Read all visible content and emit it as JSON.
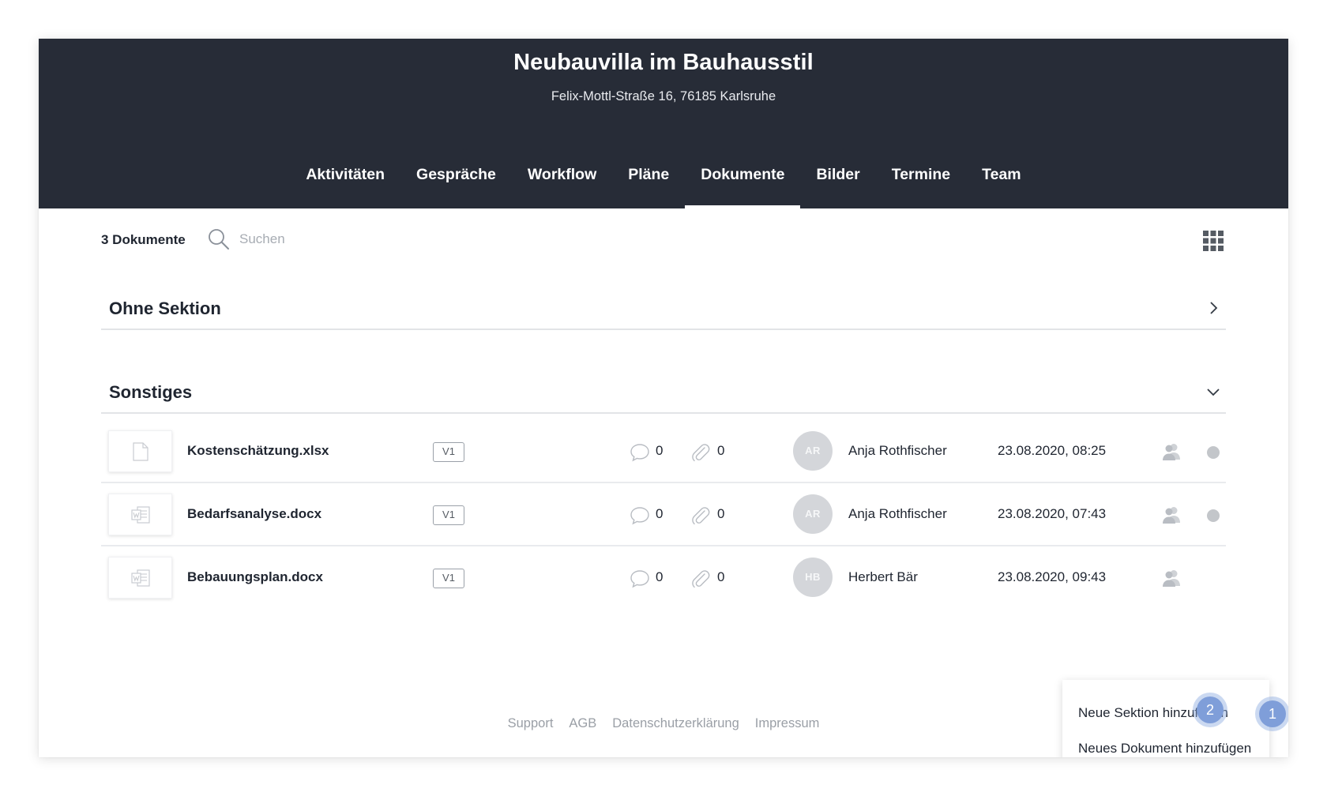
{
  "project": {
    "title": "Neubauvilla im Bauhausstil",
    "address": "Felix-Mottl-Straße 16, 76185 Karlsruhe"
  },
  "nav": {
    "tabs": [
      {
        "label": "Aktivitäten"
      },
      {
        "label": "Gespräche"
      },
      {
        "label": "Workflow"
      },
      {
        "label": "Pläne"
      },
      {
        "label": "Dokumente",
        "active": true
      },
      {
        "label": "Bilder"
      },
      {
        "label": "Termine"
      },
      {
        "label": "Team"
      }
    ]
  },
  "toolbar": {
    "doc_count": "3 Dokumente",
    "search_placeholder": "Suchen"
  },
  "sections": [
    {
      "title": "Ohne Sektion",
      "state": "collapsed"
    },
    {
      "title": "Sonstiges",
      "state": "expanded"
    }
  ],
  "documents": [
    {
      "name": "Kostenschätzung.xlsx",
      "version": "V1",
      "comments": "0",
      "attachments": "0",
      "initials": "AR",
      "author": "Anja Rothfischer",
      "date": "23.08.2020, 08:25",
      "thumb_icon": "file-icon",
      "status_dot": true
    },
    {
      "name": "Bedarfsanalyse.docx",
      "version": "V1",
      "comments": "0",
      "attachments": "0",
      "initials": "AR",
      "author": "Anja Rothfischer",
      "date": "23.08.2020, 07:43",
      "thumb_icon": "word-doc-icon",
      "status_dot": true
    },
    {
      "name": "Bebauungsplan.docx",
      "version": "V1",
      "comments": "0",
      "attachments": "0",
      "initials": "HB",
      "author": "Herbert Bär",
      "date": "23.08.2020, 09:43",
      "thumb_icon": "word-doc-icon",
      "status_dot": false
    }
  ],
  "footer": {
    "links": [
      "Support",
      "AGB",
      "Datenschutzerklärung",
      "Impressum"
    ]
  },
  "menu": {
    "items": [
      "Neue Sektion hinzufügen",
      "Neues Dokument hinzufügen"
    ]
  },
  "badges": [
    "1",
    "2"
  ],
  "colors": {
    "header_bg": "#272c37",
    "badge": "#7f9ed9",
    "avatar_bg": "#d4d6da",
    "status_dot": "#c3c6ca"
  }
}
